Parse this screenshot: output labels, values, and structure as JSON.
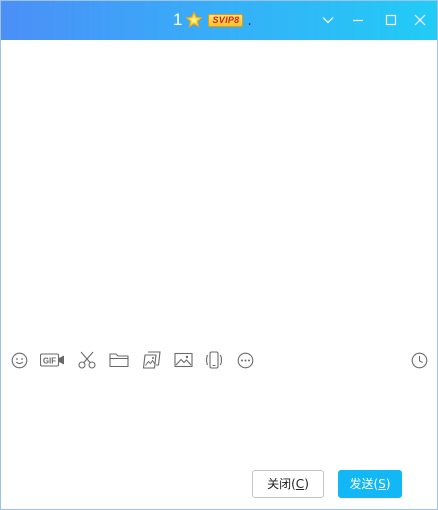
{
  "window": {
    "title_name": "1",
    "svip_badge": "SVIP8",
    "title_trailing": ".",
    "controls": {
      "dropdown_icon": "chevron-down-icon",
      "minimize_icon": "minimize-icon",
      "maximize_icon": "maximize-icon",
      "close_icon": "close-icon"
    }
  },
  "theme": {
    "titlebar_gradient": [
      "#4b8ff7",
      "#37aef8",
      "#21ccf5"
    ],
    "send_button_color": "#12b7f5",
    "toolbar_icon_color": "#6a6a6a"
  },
  "toolbar": {
    "items": [
      {
        "name": "emoji",
        "icon": "smiley-icon"
      },
      {
        "name": "gif",
        "icon": "gif-icon",
        "label": "GIF"
      },
      {
        "name": "screenshot",
        "icon": "scissors-icon"
      },
      {
        "name": "file",
        "icon": "folder-icon"
      },
      {
        "name": "image-gallery",
        "icon": "gallery-icon"
      },
      {
        "name": "image",
        "icon": "image-icon"
      },
      {
        "name": "shake",
        "icon": "shake-phone-icon"
      },
      {
        "name": "more",
        "icon": "more-icon"
      }
    ],
    "history_icon": "clock-icon"
  },
  "buttons": {
    "close_label": "关闭(",
    "close_accel": "C",
    "close_suffix": ")",
    "send_label": "发送(",
    "send_accel": "S",
    "send_suffix": ")"
  }
}
